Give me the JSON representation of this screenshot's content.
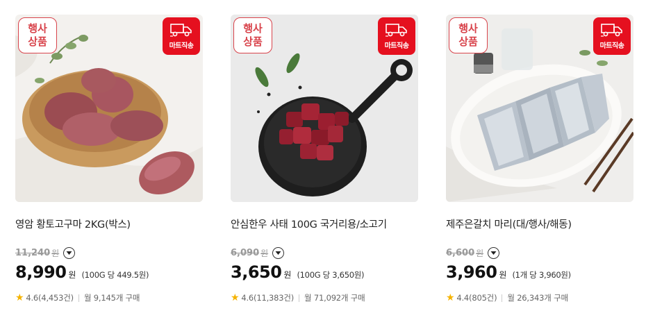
{
  "badges": {
    "event_line1": "행사",
    "event_line2": "상품",
    "mart": "마트직송"
  },
  "icons": {
    "star": "star-icon",
    "delivery": "delivery-truck-icon",
    "info": "chevron-down-icon"
  },
  "colors": {
    "accent_red": "#e5101f",
    "star": "#f5b300"
  },
  "products": [
    {
      "title": "영암 황토고구마 2KG(박스)",
      "original_price": "11,240",
      "original_won": "원",
      "price": "8,990",
      "price_won": "원",
      "unit_price": "(100G 당 449.5원)",
      "rating": "4.6(4,453건)",
      "monthly": "월 9,145개 구매"
    },
    {
      "title": "안심한우 사태 100G 국거리용/소고기",
      "original_price": "6,090",
      "original_won": "원",
      "price": "3,650",
      "price_won": "원",
      "unit_price": "(100G 당 3,650원)",
      "rating": "4.6(11,383건)",
      "monthly": "월 71,092개 구매"
    },
    {
      "title": "제주은갈치 마리(대/행사/해동)",
      "original_price": "6,600",
      "original_won": "원",
      "price": "3,960",
      "price_won": "원",
      "unit_price": "(1개 당 3,960원)",
      "rating": "4.4(805건)",
      "monthly": "월 26,343개 구매"
    }
  ]
}
